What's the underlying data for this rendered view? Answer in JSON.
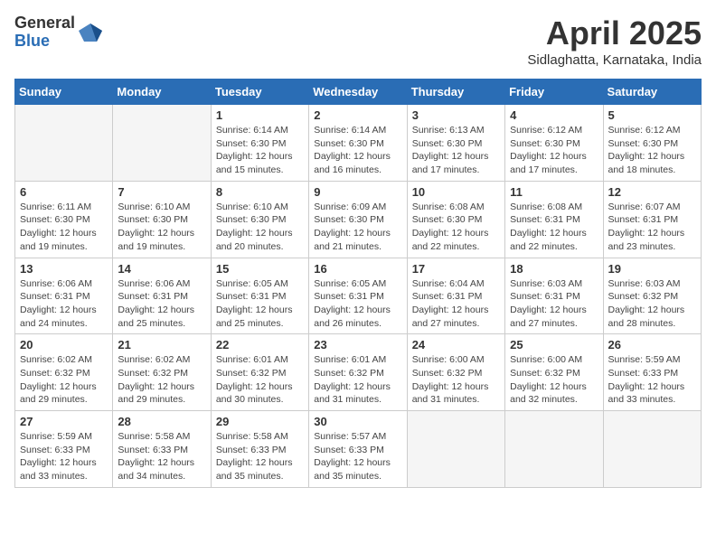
{
  "header": {
    "logo_general": "General",
    "logo_blue": "Blue",
    "month_title": "April 2025",
    "subtitle": "Sidlaghatta, Karnataka, India"
  },
  "weekdays": [
    "Sunday",
    "Monday",
    "Tuesday",
    "Wednesday",
    "Thursday",
    "Friday",
    "Saturday"
  ],
  "weeks": [
    [
      {
        "day": "",
        "info": ""
      },
      {
        "day": "",
        "info": ""
      },
      {
        "day": "1",
        "info": "Sunrise: 6:14 AM\nSunset: 6:30 PM\nDaylight: 12 hours and 15 minutes."
      },
      {
        "day": "2",
        "info": "Sunrise: 6:14 AM\nSunset: 6:30 PM\nDaylight: 12 hours and 16 minutes."
      },
      {
        "day": "3",
        "info": "Sunrise: 6:13 AM\nSunset: 6:30 PM\nDaylight: 12 hours and 17 minutes."
      },
      {
        "day": "4",
        "info": "Sunrise: 6:12 AM\nSunset: 6:30 PM\nDaylight: 12 hours and 17 minutes."
      },
      {
        "day": "5",
        "info": "Sunrise: 6:12 AM\nSunset: 6:30 PM\nDaylight: 12 hours and 18 minutes."
      }
    ],
    [
      {
        "day": "6",
        "info": "Sunrise: 6:11 AM\nSunset: 6:30 PM\nDaylight: 12 hours and 19 minutes."
      },
      {
        "day": "7",
        "info": "Sunrise: 6:10 AM\nSunset: 6:30 PM\nDaylight: 12 hours and 19 minutes."
      },
      {
        "day": "8",
        "info": "Sunrise: 6:10 AM\nSunset: 6:30 PM\nDaylight: 12 hours and 20 minutes."
      },
      {
        "day": "9",
        "info": "Sunrise: 6:09 AM\nSunset: 6:30 PM\nDaylight: 12 hours and 21 minutes."
      },
      {
        "day": "10",
        "info": "Sunrise: 6:08 AM\nSunset: 6:30 PM\nDaylight: 12 hours and 22 minutes."
      },
      {
        "day": "11",
        "info": "Sunrise: 6:08 AM\nSunset: 6:31 PM\nDaylight: 12 hours and 22 minutes."
      },
      {
        "day": "12",
        "info": "Sunrise: 6:07 AM\nSunset: 6:31 PM\nDaylight: 12 hours and 23 minutes."
      }
    ],
    [
      {
        "day": "13",
        "info": "Sunrise: 6:06 AM\nSunset: 6:31 PM\nDaylight: 12 hours and 24 minutes."
      },
      {
        "day": "14",
        "info": "Sunrise: 6:06 AM\nSunset: 6:31 PM\nDaylight: 12 hours and 25 minutes."
      },
      {
        "day": "15",
        "info": "Sunrise: 6:05 AM\nSunset: 6:31 PM\nDaylight: 12 hours and 25 minutes."
      },
      {
        "day": "16",
        "info": "Sunrise: 6:05 AM\nSunset: 6:31 PM\nDaylight: 12 hours and 26 minutes."
      },
      {
        "day": "17",
        "info": "Sunrise: 6:04 AM\nSunset: 6:31 PM\nDaylight: 12 hours and 27 minutes."
      },
      {
        "day": "18",
        "info": "Sunrise: 6:03 AM\nSunset: 6:31 PM\nDaylight: 12 hours and 27 minutes."
      },
      {
        "day": "19",
        "info": "Sunrise: 6:03 AM\nSunset: 6:32 PM\nDaylight: 12 hours and 28 minutes."
      }
    ],
    [
      {
        "day": "20",
        "info": "Sunrise: 6:02 AM\nSunset: 6:32 PM\nDaylight: 12 hours and 29 minutes."
      },
      {
        "day": "21",
        "info": "Sunrise: 6:02 AM\nSunset: 6:32 PM\nDaylight: 12 hours and 29 minutes."
      },
      {
        "day": "22",
        "info": "Sunrise: 6:01 AM\nSunset: 6:32 PM\nDaylight: 12 hours and 30 minutes."
      },
      {
        "day": "23",
        "info": "Sunrise: 6:01 AM\nSunset: 6:32 PM\nDaylight: 12 hours and 31 minutes."
      },
      {
        "day": "24",
        "info": "Sunrise: 6:00 AM\nSunset: 6:32 PM\nDaylight: 12 hours and 31 minutes."
      },
      {
        "day": "25",
        "info": "Sunrise: 6:00 AM\nSunset: 6:32 PM\nDaylight: 12 hours and 32 minutes."
      },
      {
        "day": "26",
        "info": "Sunrise: 5:59 AM\nSunset: 6:33 PM\nDaylight: 12 hours and 33 minutes."
      }
    ],
    [
      {
        "day": "27",
        "info": "Sunrise: 5:59 AM\nSunset: 6:33 PM\nDaylight: 12 hours and 33 minutes."
      },
      {
        "day": "28",
        "info": "Sunrise: 5:58 AM\nSunset: 6:33 PM\nDaylight: 12 hours and 34 minutes."
      },
      {
        "day": "29",
        "info": "Sunrise: 5:58 AM\nSunset: 6:33 PM\nDaylight: 12 hours and 35 minutes."
      },
      {
        "day": "30",
        "info": "Sunrise: 5:57 AM\nSunset: 6:33 PM\nDaylight: 12 hours and 35 minutes."
      },
      {
        "day": "",
        "info": ""
      },
      {
        "day": "",
        "info": ""
      },
      {
        "day": "",
        "info": ""
      }
    ]
  ]
}
